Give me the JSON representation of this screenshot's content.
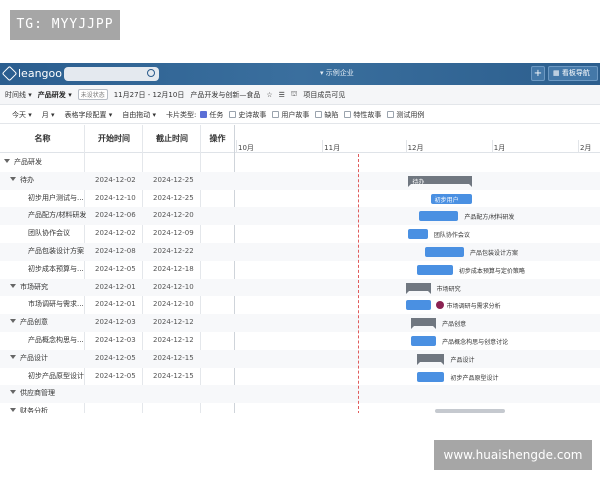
{
  "watermarks": {
    "top": "TG: MYYJJPP",
    "bottom": "www.huaishengde.com"
  },
  "nav": {
    "logo": "leangoo",
    "org": "示例企业",
    "plus": "+",
    "board_nav": "看板导航"
  },
  "projbar": {
    "view": "时间线",
    "project": "产品研发",
    "status": "未设状态",
    "dates": "11月27日 - 12月10日",
    "sprint": "产品开发与创新—食品",
    "team": "项目成员可见"
  },
  "toolbar": {
    "today": "今天",
    "month": "月",
    "fields": "表格字段配置",
    "auto": "自由拖动",
    "card_type": "卡片类型:",
    "task": "任务",
    "story": "史诗故事",
    "user_story": "用户故事",
    "bug": "缺陷",
    "feature": "特性故事",
    "test": "测试用例"
  },
  "columns": {
    "name": "名称",
    "start": "开始时间",
    "end": "截止时间",
    "ops": "操作"
  },
  "months": [
    "10月",
    "11月",
    "12月",
    "1月",
    "2月"
  ],
  "rows": [
    {
      "name": "产品研发",
      "level": 0,
      "group": true
    },
    {
      "name": "待办",
      "level": 1,
      "group": true,
      "start": "2024-12-02",
      "end": "2024-12-25",
      "bar_label": "待办"
    },
    {
      "name": "初步用户测试与...",
      "level": 2,
      "start": "2024-12-10",
      "end": "2024-12-25",
      "bar_label": "初步用户"
    },
    {
      "name": "产品配方/材料研发",
      "level": 2,
      "start": "2024-12-06",
      "end": "2024-12-20",
      "bar_label": "产品配方/材料研发"
    },
    {
      "name": "团队协作会议",
      "level": 2,
      "start": "2024-12-02",
      "end": "2024-12-09",
      "bar_label": "团队协作会议"
    },
    {
      "name": "产品包装设计方案",
      "level": 2,
      "start": "2024-12-08",
      "end": "2024-12-22",
      "bar_label": "产品包装设计方案"
    },
    {
      "name": "初步成本预算与...",
      "level": 2,
      "start": "2024-12-05",
      "end": "2024-12-18",
      "bar_label": "初步成本预算与定价策略"
    },
    {
      "name": "市场研究",
      "level": 1,
      "group": true,
      "start": "2024-12-01",
      "end": "2024-12-10",
      "bar_label": "市场研究"
    },
    {
      "name": "市场调研与需求...",
      "level": 2,
      "start": "2024-12-01",
      "end": "2024-12-10",
      "bar_label": "市场调研与需求分析"
    },
    {
      "name": "产品创意",
      "level": 1,
      "group": true,
      "start": "2024-12-03",
      "end": "2024-12-12",
      "bar_label": "产品创意"
    },
    {
      "name": "产品概念构思与...",
      "level": 2,
      "start": "2024-12-03",
      "end": "2024-12-12",
      "bar_label": "产品概念构思与创意讨论"
    },
    {
      "name": "产品设计",
      "level": 1,
      "group": true,
      "start": "2024-12-05",
      "end": "2024-12-15",
      "bar_label": "产品设计"
    },
    {
      "name": "初步产品原型设计",
      "level": 2,
      "start": "2024-12-05",
      "end": "2024-12-15",
      "bar_label": "初步产品原型设计"
    },
    {
      "name": "供应商管理",
      "level": 1,
      "group": true
    },
    {
      "name": "财务分析",
      "level": 1,
      "group": true
    }
  ]
}
